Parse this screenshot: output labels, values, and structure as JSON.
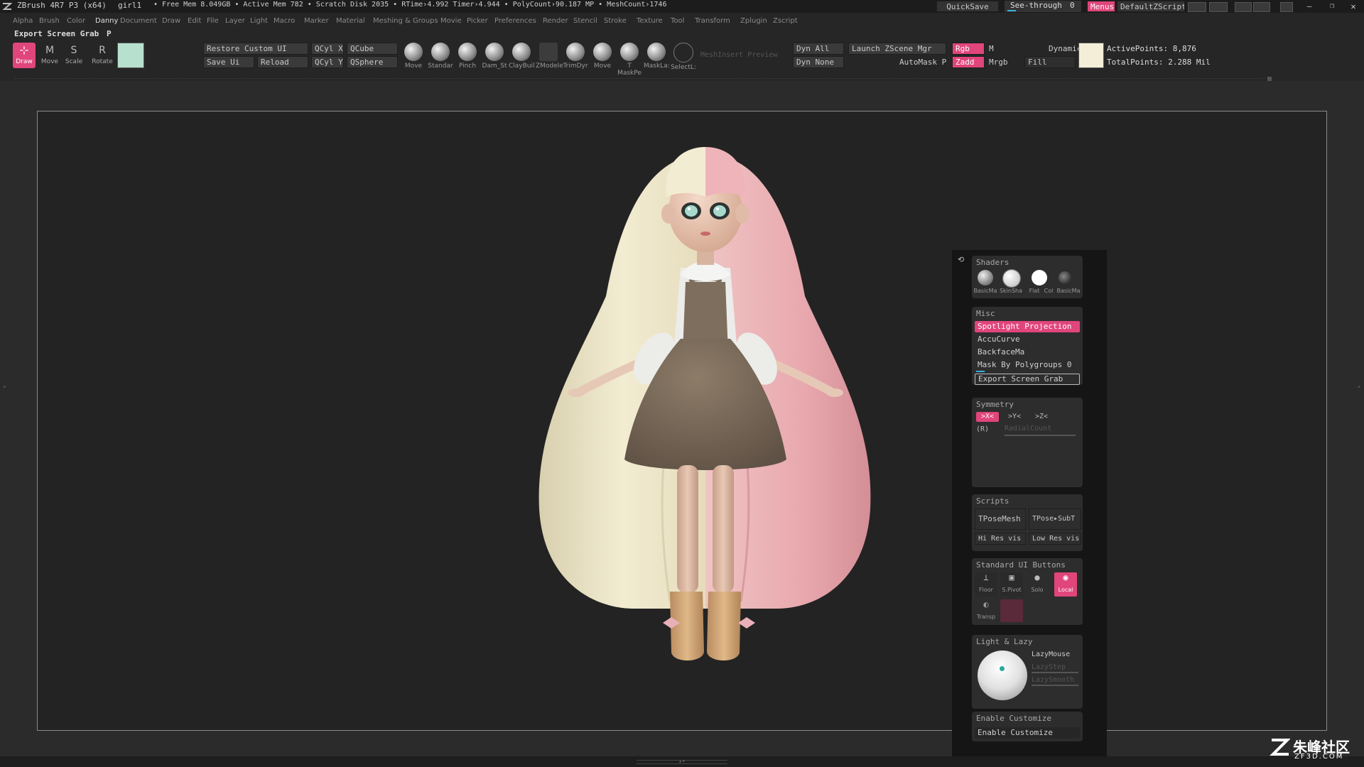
{
  "titlebar": {
    "app": "ZBrush 4R7 P3 (x64)",
    "doc": "girl1",
    "stats": "• Free Mem 8.049GB • Active Mem 782 • Scratch Disk 2035 • RTime›4.992 Timer›4.944 • PolyCount›90.187 MP • MeshCount›1746",
    "quicksave": "QuickSave",
    "seethrough": "See-through",
    "seethrough_value": "0",
    "menus": "Menus",
    "default_script": "DefaultZScript"
  },
  "menubar": {
    "items": [
      "Alpha",
      "Brush",
      "Color",
      "Danny",
      "Document",
      "Draw",
      "Edit",
      "File",
      "Layer",
      "Light",
      "Macro",
      "Marker",
      "Material",
      "Meshing & Groups",
      "Movie",
      "Picker",
      "Preferences",
      "Render",
      "Stencil",
      "Stroke",
      "Texture",
      "Tool",
      "Transform",
      "Zplugin",
      "Zscript"
    ],
    "active": "Danny"
  },
  "shelf": {
    "export_label": "Export Screen Grab",
    "export_hotkey": "P",
    "modes": [
      "Draw",
      "Move",
      "Scale",
      "Rotate"
    ],
    "buttons": {
      "restore_custom_ui": "Restore Custom UI",
      "save_ui": "Save Ui",
      "reload": "Reload",
      "qcyl_x": "QCyl X",
      "qcyl_y": "QCyl Y",
      "qcube": "QCube",
      "qsphere": "QSphere"
    },
    "brushes": [
      "Move",
      "Standar",
      "Pinch",
      "Dam_St",
      "ClayBuil",
      "ZModele",
      "TrimDyr",
      "Move",
      "T MaskPe",
      "MaskLa:",
      "SelectL:"
    ],
    "mesh_insert_preview": "MeshInsert Preview",
    "dyn_all": "Dyn All",
    "dyn_none": "Dyn None",
    "launch_zscene": "Launch ZScene Mgr",
    "automask": "AutoMask P",
    "rgb": "Rgb",
    "m": "M",
    "zadd": "Zadd",
    "mrgb": "Mrgb",
    "dynamic": "Dynamic",
    "fill": "Fill",
    "active_points": "ActivePoints: 8,876",
    "total_points": "TotalPoints: 2.288 Mil",
    "color_swatch": "#b8e0cf",
    "material_swatch": "#f4eed8"
  },
  "panel": {
    "shaders": {
      "title": "Shaders",
      "items": [
        "BasicMa",
        "SkinSha",
        "Flat",
        "Col",
        "BasicMa"
      ]
    },
    "misc": {
      "title": "Misc",
      "spotlight": "Spotlight Projection",
      "accucurve": "AccuCurve",
      "backface": "BackfaceMa",
      "mask_polygroups": "Mask By Polygroups",
      "mask_polygroups_value": "0",
      "export": "Export Screen Grab"
    },
    "symmetry": {
      "title": "Symmetry",
      "x": ">X<",
      "y": ">Y<",
      "z": ">Z<",
      "r": "(R)",
      "radial": "RadialCount"
    },
    "scripts": {
      "title": "Scripts",
      "tpose_mesh": "TPoseMesh",
      "tpose_sub": "TPose▸SubT",
      "hi_res": "Hi Res vis",
      "low_res": "Low Res vis"
    },
    "standard": {
      "title": "Standard UI Buttons",
      "floor": "Floor",
      "spivot": "S.Pivot",
      "solo": "Solo",
      "local": "Local",
      "transp": "Transp"
    },
    "light_lazy": {
      "title": "Light & Lazy",
      "lazymouse": "LazyMouse",
      "lazystep": "LazyStep",
      "lazysmooth": "LazySmooth"
    },
    "customize": {
      "title": "Enable Customize",
      "button": "Enable Customize"
    }
  },
  "watermark": {
    "cn": "朱峰社区",
    "url": "ZF3D.COM"
  },
  "colors": {
    "accent_pink": "#e0457b",
    "hair_blonde": "#ece4c4",
    "hair_pink": "#e8aab0",
    "skirt": "#7a6a58",
    "boots": "#d0a878"
  }
}
